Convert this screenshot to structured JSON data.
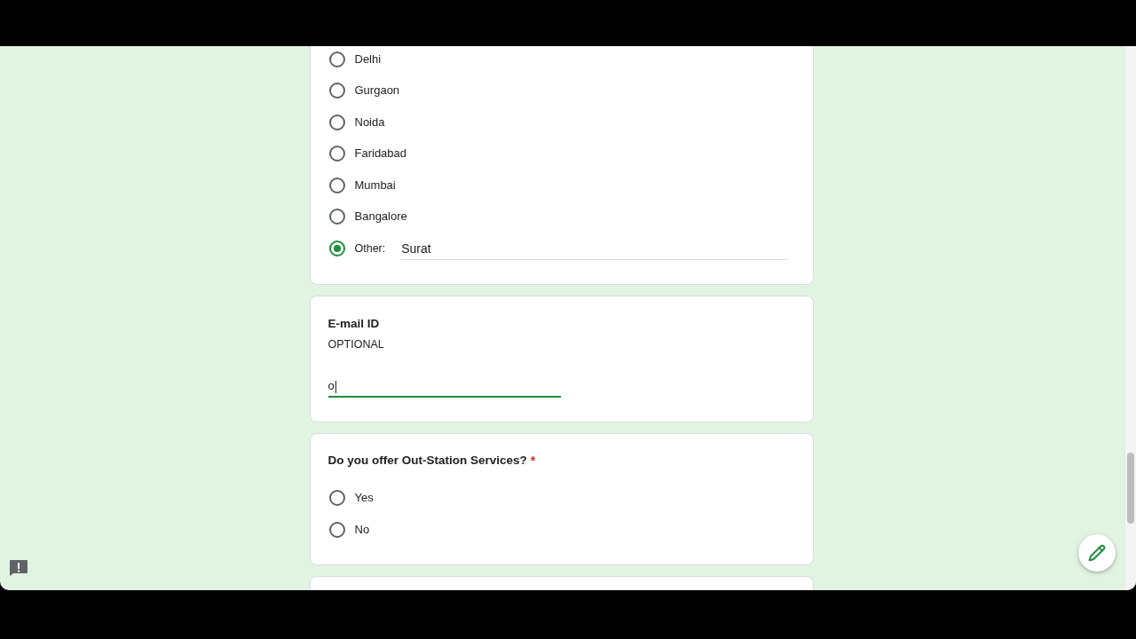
{
  "questions": [
    {
      "kind": "choice",
      "options": [
        {
          "label": "Delhi",
          "selected": false
        },
        {
          "label": "Gurgaon",
          "selected": false
        },
        {
          "label": "Noida",
          "selected": false
        },
        {
          "label": "Faridabad",
          "selected": false
        },
        {
          "label": "Mumbai",
          "selected": false
        },
        {
          "label": "Bangalore",
          "selected": false
        }
      ],
      "other": {
        "label": "Other:",
        "selected": true,
        "value": "Surat",
        "focused": false
      }
    },
    {
      "kind": "short_text",
      "title": "E-mail ID",
      "description": "OPTIONAL",
      "value": "o",
      "focused": true
    },
    {
      "kind": "choice",
      "title": "Do you offer Out-Station Services?",
      "required_mark": "*",
      "options": [
        {
          "label": "Yes",
          "selected": false
        },
        {
          "label": "No",
          "selected": false
        }
      ]
    }
  ]
}
